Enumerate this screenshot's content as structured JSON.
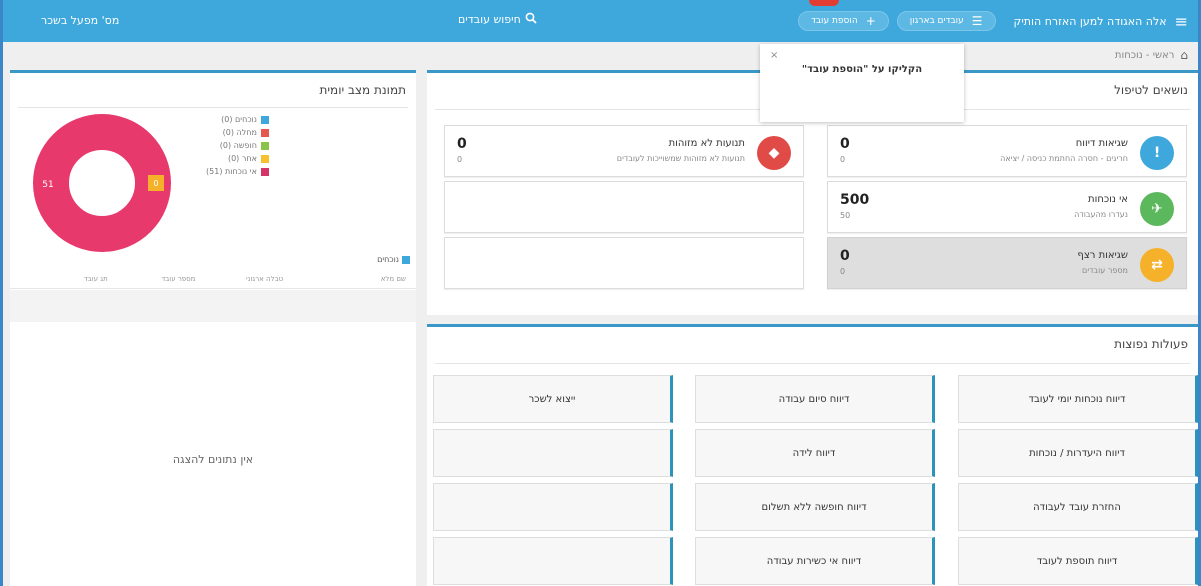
{
  "topbar": {
    "org_name": "אלה האגודה למען האזרח הותיק",
    "filter_pill": "עובדים בארגון",
    "add_pill": "הוספת עובד",
    "search_label": "חיפוש עובדים",
    "employer_label": "מס' מפעל בשכר"
  },
  "breadcrumb": {
    "text": "ראשי - נוכחות"
  },
  "popover": {
    "close": "×",
    "message": "הקליקו על \"הוספת עובד\""
  },
  "daily": {
    "title": "תמונת מצב יומית",
    "legend": [
      {
        "label": "נוכחים (0)",
        "color": "#3ea7db"
      },
      {
        "label": "מחלה (0)",
        "color": "#e8574e"
      },
      {
        "label": "חופשה (0)",
        "color": "#8bc34a"
      },
      {
        "label": "אחר (0)",
        "color": "#f6c12b"
      },
      {
        "label": "אי נוכחות (51)",
        "color": "#d63368"
      }
    ],
    "donut": {
      "main_value": "51",
      "small_value": "0",
      "main_color": "#e8396d",
      "small_color": "#f6b12b"
    },
    "present_label": "נוכחים",
    "columns": [
      "שם מלא",
      "טבלה ארגוני",
      "מספר עובד",
      "תג עובד"
    ],
    "no_data": "אין נתונים להצגה"
  },
  "topics": {
    "title": "נושאים לטיפול",
    "cards": [
      {
        "title": "שגיאות דיווח",
        "sub": "חריגים - חסרה החתמת כניסה / יציאה",
        "num": "0",
        "num2": "0",
        "color": "#3ea7db",
        "icon": "!"
      },
      {
        "title": "תנועות לא מזוהות",
        "sub": "תנועות לא מזוהות שמשוייכות לעובדים",
        "num": "0",
        "num2": "0",
        "color": "#e04b47",
        "icon": "◆"
      },
      {
        "title": "אי נוכחות",
        "sub": "נעדרו מהעבודה",
        "num": "500",
        "num2": "50",
        "color": "#5cb85c",
        "icon": "✈"
      },
      {
        "title": "שגיאות רצף",
        "sub": "מספר עובדים",
        "num": "0",
        "num2": "0",
        "color": "#f6b12b",
        "icon": "⇄"
      }
    ]
  },
  "actions": {
    "title": "פעולות נפוצות",
    "buttons": [
      "דיווח נוכחות יומי לעובד",
      "דיווח סיום עבודה",
      "ייצוא לשכר",
      "דיווח היעדרות / נוכחות",
      "דיווח לידה",
      "",
      "החזרת עובד לעבודה",
      "דיווח חופשה ללא תשלום",
      "",
      "דיווח תוספת לעובד",
      "דיווח אי כשירות עבודה",
      ""
    ]
  }
}
